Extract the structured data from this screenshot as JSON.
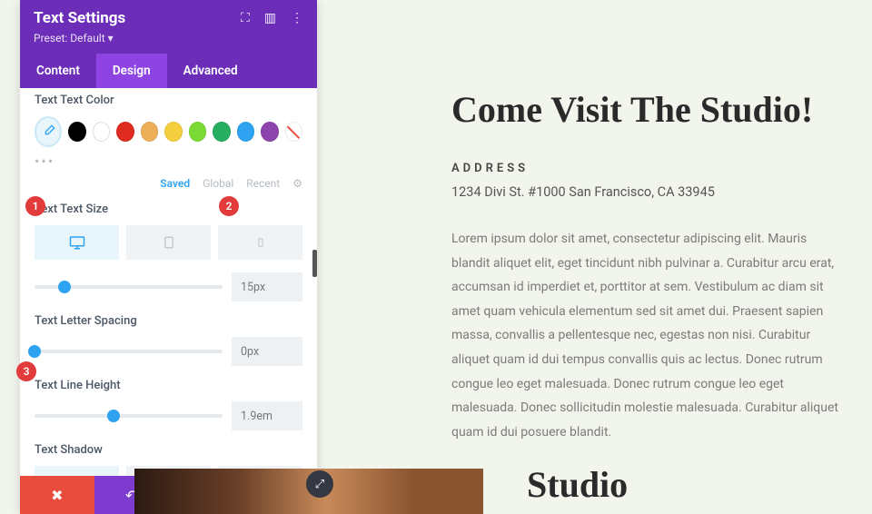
{
  "panel": {
    "title": "Text Settings",
    "preset": "Preset: Default ▾",
    "tabs": {
      "content": "Content",
      "design": "Design",
      "advanced": "Advanced"
    }
  },
  "sections": {
    "text_color": "Text Text Color",
    "text_size": "Text Text Size",
    "letter_spacing": "Text Letter Spacing",
    "line_height": "Text Line Height",
    "text_shadow": "Text Shadow"
  },
  "saved_tabs": {
    "saved": "Saved",
    "global": "Global",
    "recent": "Recent"
  },
  "colors": [
    "#000000",
    "#ffffff",
    "#e02b20",
    "#edb059",
    "#f4d03f",
    "#7bdb34",
    "#27ae60",
    "#2ea3f2",
    "#8e44ad"
  ],
  "values": {
    "text_size": "15px",
    "letter_spacing": "0px",
    "line_height": "1.9em"
  },
  "slider_pos": {
    "text_size": 16,
    "letter_spacing": 0,
    "line_height": 42
  },
  "preview": {
    "heading": "Come Visit The Studio!",
    "address_label": "ADDRESS",
    "address": "1234 Divi St. #1000 San Francisco, CA 33945",
    "body": "Lorem ipsum dolor sit amet, consectetur adipiscing elit. Mauris blandit aliquet elit, eget tincidunt nibh pulvinar a. Curabitur arcu erat, accumsan id imperdiet et, porttitor at sem. Vestibulum ac diam sit amet quam vehicula elementum sed sit amet dui. Praesent sapien massa, convallis a pellentesque nec, egestas non nisi. Curabitur aliquet quam id dui tempus convallis quis ac lectus. Donec rutrum congue leo eget malesuada. Donec rutrum congue leo eget malesuada. Donec sollicitudin molestie malesuada. Curabitur aliquet quam id dui posuere blandit.",
    "studio": "Studio"
  },
  "badges": {
    "1": "1",
    "2": "2",
    "3": "3"
  }
}
